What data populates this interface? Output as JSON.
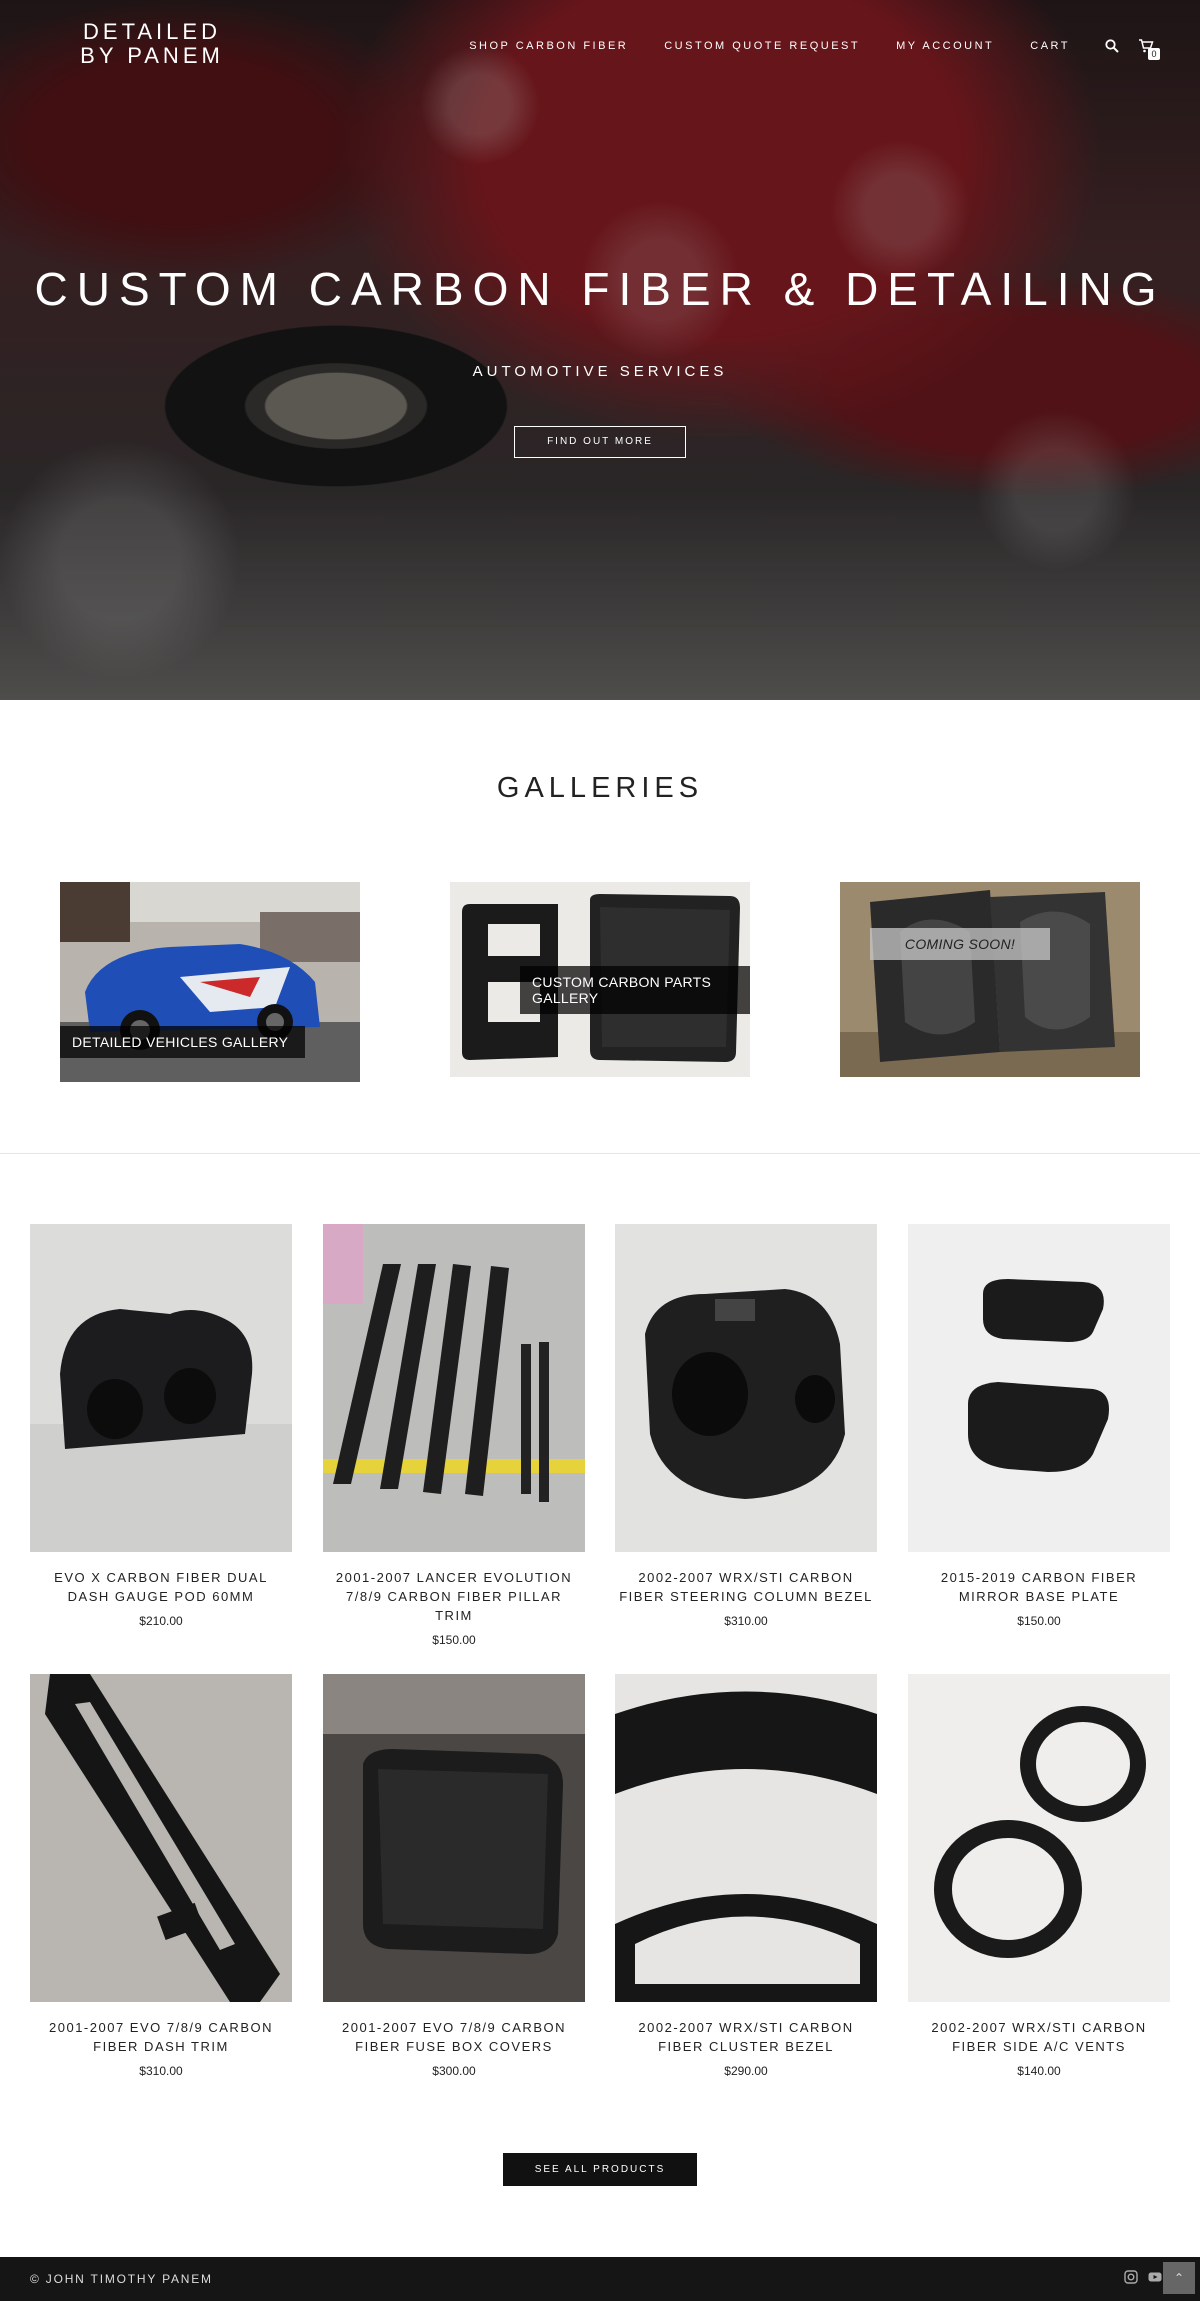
{
  "header": {
    "logo": "DETAILED BY PANEM",
    "nav": [
      "SHOP CARBON FIBER",
      "CUSTOM QUOTE REQUEST",
      "MY ACCOUNT",
      "CART"
    ],
    "cart_count": "0",
    "icons": [
      "search-icon",
      "cart-icon"
    ]
  },
  "hero": {
    "title": "CUSTOM CARBON FIBER & DETAILING",
    "subtitle": "AUTOMOTIVE SERVICES",
    "button": "FIND OUT MORE"
  },
  "galleries": {
    "title": "GALLERIES",
    "items": [
      {
        "label": "DETAILED VEHICLES GALLERY"
      },
      {
        "label": "CUSTOM CARBON PARTS GALLERY"
      },
      {
        "label": "COMING SOON!"
      }
    ]
  },
  "products": [
    {
      "title": "EVO X CARBON FIBER DUAL DASH GAUGE POD 60MM",
      "price": "$210.00"
    },
    {
      "title": "2001-2007 LANCER EVOLUTION 7/8/9 CARBON FIBER PILLAR TRIM",
      "price": "$150.00"
    },
    {
      "title": "2002-2007 WRX/STI CARBON FIBER STEERING COLUMN BEZEL",
      "price": "$310.00"
    },
    {
      "title": "2015-2019 CARBON FIBER MIRROR BASE PLATE",
      "price": "$150.00"
    },
    {
      "title": "2001-2007 EVO 7/8/9 CARBON FIBER DASH TRIM",
      "price": "$310.00"
    },
    {
      "title": "2001-2007 EVO 7/8/9 CARBON FIBER FUSE BOX COVERS",
      "price": "$300.00"
    },
    {
      "title": "2002-2007 WRX/STI CARBON FIBER CLUSTER BEZEL",
      "price": "$290.00"
    },
    {
      "title": "2002-2007 WRX/STI CARBON FIBER SIDE A/C VENTS",
      "price": "$140.00"
    }
  ],
  "see_all": "SEE ALL PRODUCTS",
  "footer": {
    "copyright": "© JOHN TIMOTHY PANEM",
    "icons": [
      "instagram-icon",
      "youtube-icon",
      "back-to-top-icon"
    ]
  }
}
